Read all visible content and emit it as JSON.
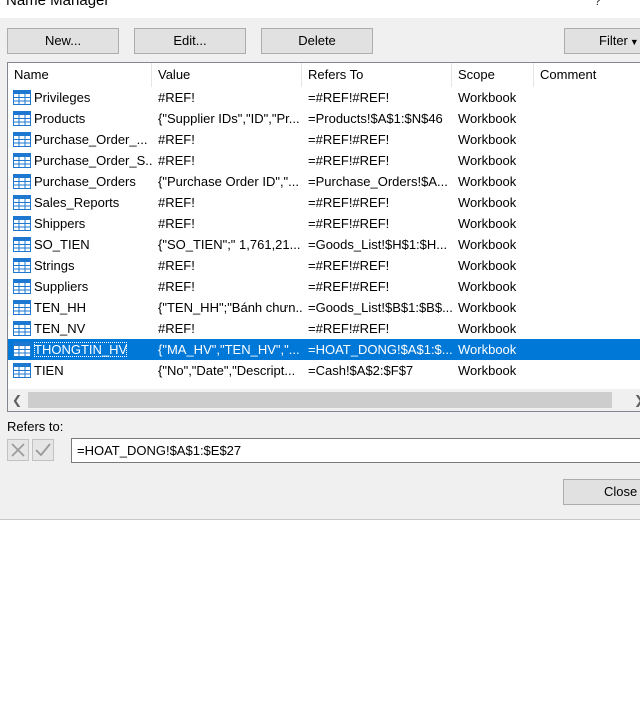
{
  "title": "Name Manager",
  "help_label": "?",
  "toolbar": {
    "new_label": "New...",
    "edit_label": "Edit...",
    "delete_label": "Delete",
    "filter_label": "Filter"
  },
  "columns": {
    "name": "Name",
    "value": "Value",
    "refers_to": "Refers To",
    "scope": "Scope",
    "comment": "Comment"
  },
  "rows": [
    {
      "name": "Privileges",
      "value": "#REF!",
      "refers_to": "=#REF!#REF!",
      "scope": "Workbook",
      "comment": ""
    },
    {
      "name": "Products",
      "value": "{\"Supplier IDs\",\"ID\",\"Pr...",
      "refers_to": "=Products!$A$1:$N$46",
      "scope": "Workbook",
      "comment": ""
    },
    {
      "name": "Purchase_Order_...",
      "value": "#REF!",
      "refers_to": "=#REF!#REF!",
      "scope": "Workbook",
      "comment": ""
    },
    {
      "name": "Purchase_Order_S...",
      "value": "#REF!",
      "refers_to": "=#REF!#REF!",
      "scope": "Workbook",
      "comment": ""
    },
    {
      "name": "Purchase_Orders",
      "value": "{\"Purchase Order ID\",\"...",
      "refers_to": "=Purchase_Orders!$A...",
      "scope": "Workbook",
      "comment": ""
    },
    {
      "name": "Sales_Reports",
      "value": "#REF!",
      "refers_to": "=#REF!#REF!",
      "scope": "Workbook",
      "comment": ""
    },
    {
      "name": "Shippers",
      "value": "#REF!",
      "refers_to": "=#REF!#REF!",
      "scope": "Workbook",
      "comment": ""
    },
    {
      "name": "SO_TIEN",
      "value": "{\"SO_TIEN\";\" 1,761,21...",
      "refers_to": "=Goods_List!$H$1:$H...",
      "scope": "Workbook",
      "comment": ""
    },
    {
      "name": "Strings",
      "value": "#REF!",
      "refers_to": "=#REF!#REF!",
      "scope": "Workbook",
      "comment": ""
    },
    {
      "name": "Suppliers",
      "value": "#REF!",
      "refers_to": "=#REF!#REF!",
      "scope": "Workbook",
      "comment": ""
    },
    {
      "name": "TEN_HH",
      "value": "{\"TEN_HH\";\"Bánh chưn...",
      "refers_to": "=Goods_List!$B$1:$B$...",
      "scope": "Workbook",
      "comment": ""
    },
    {
      "name": "TEN_NV",
      "value": "#REF!",
      "refers_to": "=#REF!#REF!",
      "scope": "Workbook",
      "comment": ""
    },
    {
      "name": "THONGTIN_HV",
      "value": "{\"MA_HV\",\"TEN_HV\",\"...",
      "refers_to": "=HOAT_DONG!$A$1:$...",
      "scope": "Workbook",
      "comment": "",
      "selected": true
    },
    {
      "name": "TIEN",
      "value": "{\"No\",\"Date\",\"Descript...",
      "refers_to": "=Cash!$A$2:$F$7",
      "scope": "Workbook",
      "comment": ""
    }
  ],
  "refers_to_label": "Refers to:",
  "refers_to_value": "=HOAT_DONG!$A$1:$E$27",
  "close_label": "Close",
  "colors": {
    "selection": "#0078d7",
    "icon_blue": "#1e78d2"
  },
  "icons": {
    "row_icon": "table-icon",
    "cancel": "cancel-x-icon",
    "confirm": "checkmark-icon"
  }
}
